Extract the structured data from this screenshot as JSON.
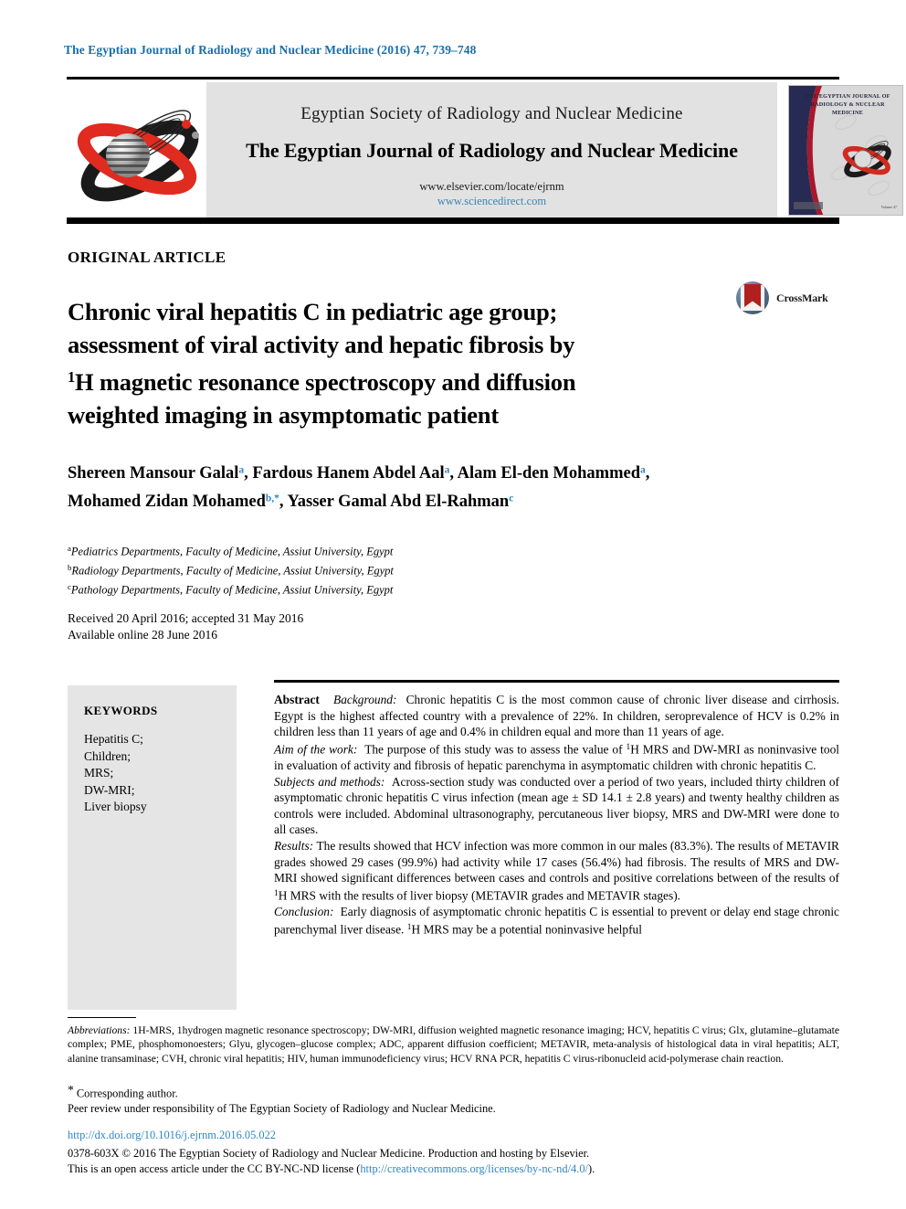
{
  "running_head": "The Egyptian Journal of Radiology and Nuclear Medicine (2016) 47, 739–748",
  "masthead": {
    "society_line": "Egyptian Society of Radiology and Nuclear Medicine",
    "journal_line": "The Egyptian Journal of Radiology and Nuclear Medicine",
    "url_elsevier": "www.elsevier.com/locate/ejrnm",
    "url_sciencedirect": "www.sciencedirect.com",
    "cover_title_lines": "THE EGYPTIAN JOURNAL OF RADIOLOGY & NUCLEAR MEDICINE",
    "cover_footer": "Volume 47"
  },
  "article_type": "ORIGINAL ARTICLE",
  "title": {
    "line1": "Chronic viral hepatitis C in pediatric age group;",
    "line2": "assessment of viral activity and hepatic fibrosis by",
    "line3_sup": "1",
    "line3": "H magnetic resonance spectroscopy and diffusion",
    "line4": "weighted imaging in asymptomatic patient"
  },
  "crossmark": {
    "label": "CrossMark"
  },
  "authors": [
    {
      "name": "Shereen Mansour Galal",
      "sup": "a",
      "sep": ", "
    },
    {
      "name": "Fardous Hanem Abdel Aal",
      "sup": "a",
      "sep": ", "
    },
    {
      "name": "Alam El-den Mohammed",
      "sup": "a",
      "sep": ", "
    },
    {
      "name": "Mohamed Zidan Mohamed",
      "sup": "b,*",
      "sep": ", "
    },
    {
      "name": "Yasser Gamal Abd El-Rahman",
      "sup": "c",
      "sep": ""
    }
  ],
  "affiliations": [
    {
      "mark": "a",
      "text": "Pediatrics Departments, Faculty of Medicine, Assiut University, Egypt"
    },
    {
      "mark": "b",
      "text": "Radiology Departments, Faculty of Medicine, Assiut University, Egypt"
    },
    {
      "mark": "c",
      "text": "Pathology Departments, Faculty of Medicine, Assiut University, Egypt"
    }
  ],
  "history": {
    "received": "Received 20 April 2016; accepted 31 May 2016",
    "available": "Available online 28 June 2016"
  },
  "keywords": {
    "heading": "KEYWORDS",
    "items": [
      "Hepatitis C;",
      "Children;",
      "MRS;",
      "DW-MRI;",
      "Liver biopsy"
    ]
  },
  "abstract": {
    "label": "Abstract",
    "sections": [
      {
        "heading": "Background:",
        "text": "Chronic hepatitis C is the most common cause of chronic liver disease and cirrhosis. Egypt is the highest affected country with a prevalence of 22%. In children, seroprevalence of HCV is 0.2% in children less than 11 years of age and 0.4% in children equal and more than 11 years of age."
      },
      {
        "heading": "Aim of the work:",
        "text_pre": "The purpose of this study was to assess the value of ",
        "sup": "1",
        "text_post": "H MRS and DW-MRI as noninvasive tool in evaluation of activity and fibrosis of hepatic parenchyma in asymptomatic children with chronic hepatitis C."
      },
      {
        "heading": "Subjects and methods:",
        "text": "Across-section study was conducted over a period of two years, included thirty children of asymptomatic chronic hepatitis C virus infection (mean age ± SD 14.1 ± 2.8 years) and twenty healthy children as controls were included. Abdominal ultrasonography, percutaneous liver biopsy, MRS and DW-MRI were done to all cases."
      },
      {
        "heading": "Results:",
        "text_pre": "The results showed that HCV infection was more common in our males (83.3%). The results of METAVIR grades showed 29 cases (99.9%) had activity while 17 cases (56.4%) had fibrosis. The results of MRS and DW-MRI showed significant differences between cases and controls and positive correlations between of the results of ",
        "sup": "1",
        "text_post": "H MRS with the results of liver biopsy (METAVIR grades and METAVIR stages)."
      },
      {
        "heading": "Conclusion:",
        "text_pre": "Early diagnosis of asymptomatic chronic hepatitis C is essential to prevent or delay end stage chronic parenchymal liver disease. ",
        "sup": "1",
        "text_post": "H MRS may be a potential noninvasive helpful"
      }
    ]
  },
  "footnotes": {
    "abbrev_label": "Abbreviations:",
    "abbrev_text": "1H-MRS, 1hydrogen magnetic resonance spectroscopy; DW-MRI, diffusion weighted magnetic resonance imaging; HCV, hepatitis C virus; Glx, glutamine–glutamate complex; PME, phosphomonoesters; Glyu, glycogen–glucose complex; ADC, apparent diffusion coefficient; METAVIR, meta-analysis of histological data in viral hepatitis; ALT, alanine transaminase; CVH, chronic viral hepatitis; HIV, human immunodeficiency virus; HCV RNA PCR, hepatitis C virus-ribonucleid acid-polymerase chain reaction.",
    "corresponding": "Corresponding author.",
    "corresponding_mark": "*",
    "peer_review": "Peer review under responsibility of The Egyptian Society of Radiology and Nuclear Medicine.",
    "doi": "http://dx.doi.org/10.1016/j.ejrnm.2016.05.022",
    "copyright_line1": "0378-603X © 2016 The Egyptian Society of Radiology and Nuclear Medicine. Production and hosting by Elsevier.",
    "license_pre": "This is an open access article under the CC BY-NC-ND license (",
    "license_link": "http://creativecommons.org/licenses/by-nc-nd/4.0/",
    "license_post": ")."
  },
  "colors": {
    "running_head": "#1a6ea8",
    "link": "#2e87c4",
    "author_sup": "#2e87c4",
    "banner_bg": "#e2e2e2",
    "keywords_bg": "#e5e5e5"
  }
}
